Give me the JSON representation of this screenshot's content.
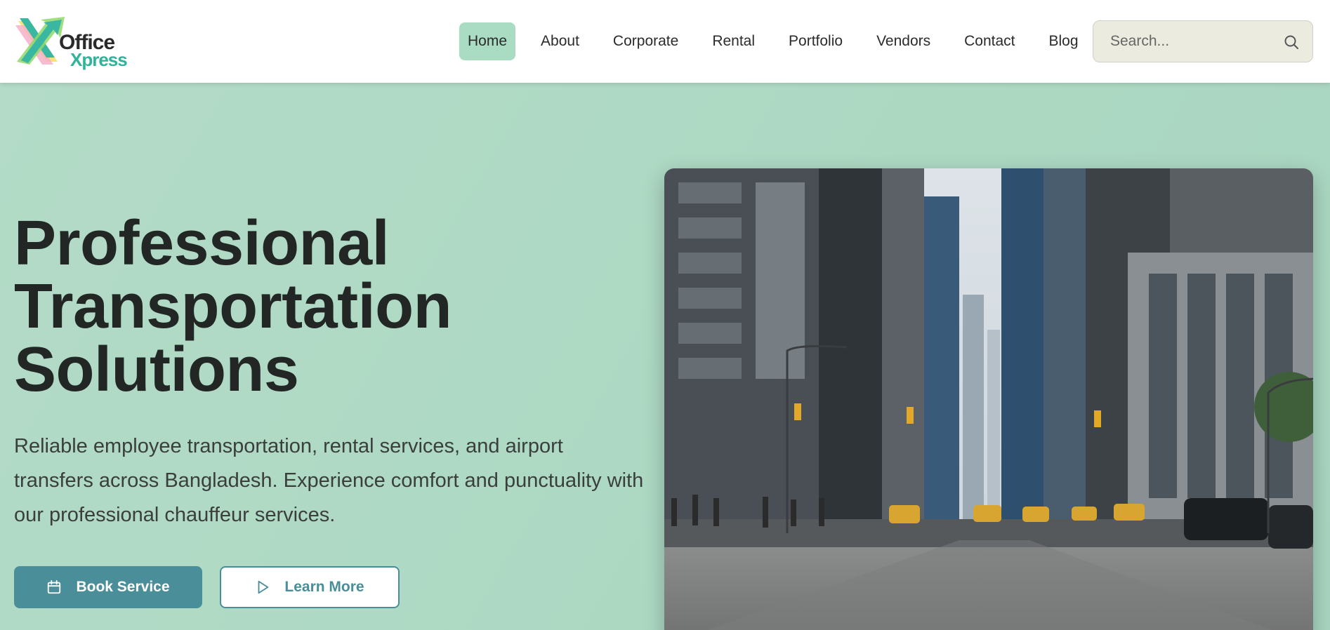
{
  "brand": {
    "name_line1": "Office",
    "name_line2": "Xpress",
    "accent": "#2fb39a",
    "logo_colors": [
      "#39b7a0",
      "#8fd868",
      "#f6b0c8",
      "#f3e56a"
    ]
  },
  "nav": {
    "items": [
      {
        "label": "Home",
        "active": true
      },
      {
        "label": "About",
        "active": false
      },
      {
        "label": "Corporate",
        "active": false
      },
      {
        "label": "Rental",
        "active": false
      },
      {
        "label": "Portfolio",
        "active": false
      },
      {
        "label": "Vendors",
        "active": false
      },
      {
        "label": "Contact",
        "active": false
      },
      {
        "label": "Blog",
        "active": false
      }
    ],
    "active_color": "#aadbc3"
  },
  "search": {
    "placeholder": "Search...",
    "icon": "search-icon"
  },
  "hero": {
    "headline_lines": [
      "Professional",
      "Transportation",
      "Solutions"
    ],
    "description": "Reliable employee transportation, rental services, and airport transfers across Bangladesh. Experience comfort and punctuality with our professional chauffeur services.",
    "primary_button": {
      "label": "Book Service",
      "icon": "calendar-icon"
    },
    "secondary_button": {
      "label": "Learn More",
      "icon": "play-icon"
    },
    "background": "#b1dbc6",
    "button_color": "#498e98",
    "image_icon": "city-street-photo"
  }
}
